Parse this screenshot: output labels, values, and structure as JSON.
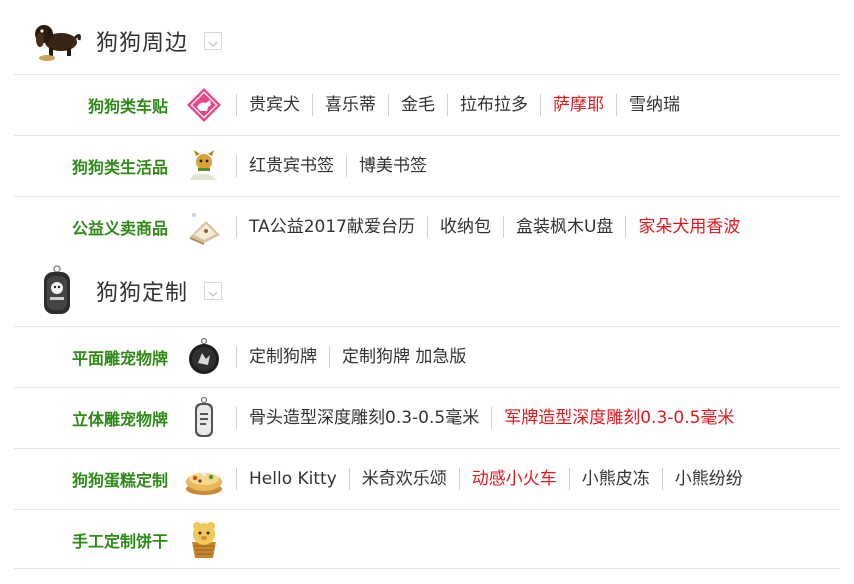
{
  "colors": {
    "category": "#2e8b17",
    "link": "#333333",
    "link_highlight": "#e0191e",
    "divider": "#e6e6e6"
  },
  "sections": [
    {
      "title": "狗狗周边",
      "icon": "dachshund-dog-icon",
      "rows": [
        {
          "category": "狗狗类车贴",
          "thumb": "pink-diamond-dog-sticker-icon",
          "links": [
            {
              "label": "贵宾犬",
              "highlight": false
            },
            {
              "label": "喜乐蒂",
              "highlight": false
            },
            {
              "label": "金毛",
              "highlight": false
            },
            {
              "label": "拉布拉多",
              "highlight": false
            },
            {
              "label": "萨摩耶",
              "highlight": true
            },
            {
              "label": "雪纳瑞",
              "highlight": false
            }
          ]
        },
        {
          "category": "狗狗类生活品",
          "thumb": "dog-bookmark-icon",
          "links": [
            {
              "label": "红贵宾书签",
              "highlight": false
            },
            {
              "label": "博美书签",
              "highlight": false
            }
          ]
        },
        {
          "category": "公益义卖商品",
          "thumb": "desk-calendar-icon",
          "links": [
            {
              "label": "TA公益2017献爱台历",
              "highlight": false
            },
            {
              "label": "收纳包",
              "highlight": false
            },
            {
              "label": "盒装枫木U盘",
              "highlight": false
            },
            {
              "label": "家朵犬用香波",
              "highlight": true
            }
          ]
        }
      ]
    },
    {
      "title": "狗狗定制",
      "icon": "dog-tag-icon",
      "rows": [
        {
          "category": "平面雕宠物牌",
          "thumb": "round-pet-tag-icon",
          "links": [
            {
              "label": "定制狗牌",
              "highlight": false
            },
            {
              "label": "定制狗牌 加急版",
              "highlight": false
            }
          ]
        },
        {
          "category": "立体雕宠物牌",
          "thumb": "military-tag-icon",
          "links": [
            {
              "label": "骨头造型深度雕刻0.3-0.5毫米",
              "highlight": false
            },
            {
              "label": "军牌造型深度雕刻0.3-0.5毫米",
              "highlight": true
            }
          ]
        },
        {
          "category": "狗狗蛋糕定制",
          "thumb": "dog-cake-icon",
          "links": [
            {
              "label": "Hello Kitty",
              "highlight": false
            },
            {
              "label": "米奇欢乐颂",
              "highlight": false
            },
            {
              "label": "动感小火车",
              "highlight": true
            },
            {
              "label": "小熊皮冻",
              "highlight": false
            },
            {
              "label": "小熊纷纷",
              "highlight": false
            }
          ]
        },
        {
          "category": "手工定制饼干",
          "thumb": "handmade-biscuit-icon",
          "links": []
        }
      ]
    }
  ]
}
